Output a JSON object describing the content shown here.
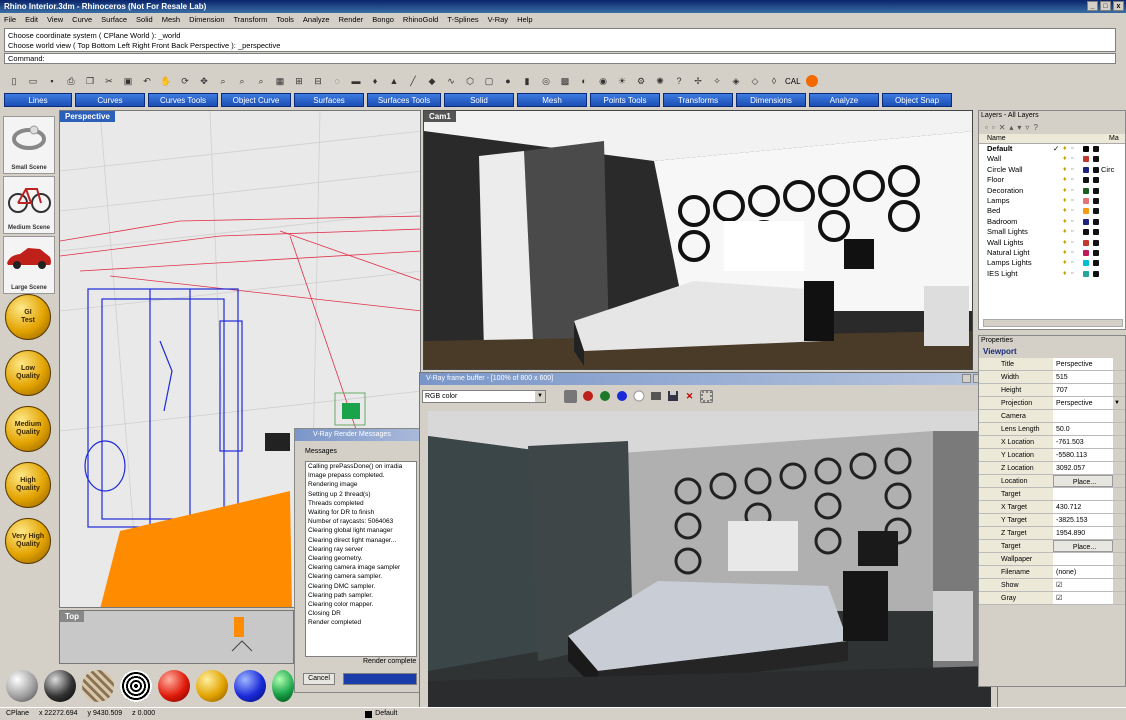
{
  "window": {
    "title": "Rhino Interior.3dm - Rhinoceros (Not For Resale Lab)",
    "controls": [
      "_",
      "□",
      "x"
    ]
  },
  "menu": [
    "File",
    "Edit",
    "View",
    "Curve",
    "Surface",
    "Solid",
    "Mesh",
    "Dimension",
    "Transform",
    "Tools",
    "Analyze",
    "Render",
    "Bongo",
    "RhinoGold",
    "T-Splines",
    "V-Ray",
    "Help"
  ],
  "command_history": [
    "Choose coordinate system ( CPlane  World ): _world",
    "Choose world view ( Top  Bottom  Left  Right  Front  Back  Perspective ): _perspective"
  ],
  "command_prompt": "Command:",
  "toolbar_text": "CAL",
  "tabs": [
    "Lines",
    "Curves",
    "Curves Tools",
    "Object Curve",
    "Surfaces",
    "Surfaces Tools",
    "Solid",
    "Mesh",
    "Points Tools",
    "Transforms",
    "Dimensions",
    "Analyze",
    "Object Snap"
  ],
  "scenes": [
    "Small Scene",
    "Medium Scene",
    "Large Scene"
  ],
  "quality": [
    [
      "GI",
      "Test"
    ],
    [
      "Low",
      "Quality"
    ],
    [
      "Medium",
      "Quality"
    ],
    [
      "High",
      "Quality"
    ],
    [
      "Very High",
      "Quality"
    ]
  ],
  "viewports": {
    "perspective": "Perspective",
    "camera": "Cam1",
    "top": "Top"
  },
  "render_messages": {
    "title": "V-Ray",
    "subtitle": "Render Messages",
    "tab": "Messages",
    "lines": [
      "Calling prePassDone() on irradia",
      "Image prepass completed.",
      "Rendering image",
      "Setting up 2 thread(s)",
      "Threads completed",
      "Waiting for DR to finish",
      "Number of raycasts: 5064063",
      "Clearing global light manager",
      "Clearing direct light manager...",
      "Clearing ray server",
      "Clearing geometry.",
      "Clearing camera image sampler",
      "Clearing camera sampler.",
      "Clearing DMC sampler.",
      "Clearing path sampler.",
      "Clearing color mapper.",
      "Closing DR",
      "Render completed"
    ],
    "cancel": "Cancel",
    "status": "Render complete",
    "progress": 1.0
  },
  "frame_buffer": {
    "title": "V-Ray frame buffer - [100% of 800 x 600]",
    "channel": "RGB color"
  },
  "layers": {
    "title": "Layers - All Layers",
    "col_name": "Name",
    "col_material": "Ma",
    "items": [
      {
        "name": "Default",
        "check": "✓",
        "color": "#000000",
        "bold": true
      },
      {
        "name": "Wall",
        "check": "",
        "color": "#c0392b"
      },
      {
        "name": "Circle Wall",
        "check": "",
        "color": "#1a237e",
        "mat": "Circ"
      },
      {
        "name": "Floor",
        "check": "",
        "color": "#111111"
      },
      {
        "name": "Decoration",
        "check": "",
        "color": "#1b5e20"
      },
      {
        "name": "Lamps",
        "check": "",
        "color": "#e57373"
      },
      {
        "name": "Bed",
        "check": "",
        "color": "#f39c12"
      },
      {
        "name": "Badroom",
        "check": "",
        "color": "#1a237e"
      },
      {
        "name": "Small Lights",
        "check": "",
        "color": "#111111"
      },
      {
        "name": "Wall Lights",
        "check": "",
        "color": "#c0392b"
      },
      {
        "name": "Natural Light",
        "check": "",
        "color": "#c2185b"
      },
      {
        "name": "Lamps Lights",
        "check": "",
        "color": "#00bcd4"
      },
      {
        "name": "IES Light",
        "check": "",
        "color": "#26a69a"
      }
    ]
  },
  "properties": {
    "title": "Properties",
    "section": "Viewport",
    "rows": [
      {
        "k": "Title",
        "v": "Perspective"
      },
      {
        "k": "Width",
        "v": "515"
      },
      {
        "k": "Height",
        "v": "707"
      },
      {
        "k": "Projection",
        "v": "Perspective",
        "dropdown": true
      },
      {
        "k": "Camera",
        "v": ""
      },
      {
        "k": "Lens Length",
        "v": "50.0"
      },
      {
        "k": "X Location",
        "v": "-761.503"
      },
      {
        "k": "Y Location",
        "v": "-5580.113"
      },
      {
        "k": "Z Location",
        "v": "3092.057"
      },
      {
        "k": "Location",
        "v": "Place...",
        "button": true
      },
      {
        "k": "Target",
        "v": ""
      },
      {
        "k": "X Target",
        "v": "430.712"
      },
      {
        "k": "Y Target",
        "v": "-3825.153"
      },
      {
        "k": "Z Target",
        "v": "1954.890"
      },
      {
        "k": "Target",
        "v": "Place...",
        "button": true
      },
      {
        "k": "Wallpaper",
        "v": ""
      },
      {
        "k": "Filename",
        "v": "(none)"
      },
      {
        "k": "Show",
        "v": "☑"
      },
      {
        "k": "Gray",
        "v": "☑"
      }
    ]
  },
  "status": {
    "cplane": "CPlane",
    "x": "x 22272.694",
    "y": "y 9430.509",
    "z": "z 0.000",
    "layer": "Default"
  },
  "colors": {
    "tab_blue": "#1b4fb5",
    "select_orange": "#ff8c00",
    "wire_blue": "#1e2ad9",
    "wire_red": "#e0304a"
  }
}
